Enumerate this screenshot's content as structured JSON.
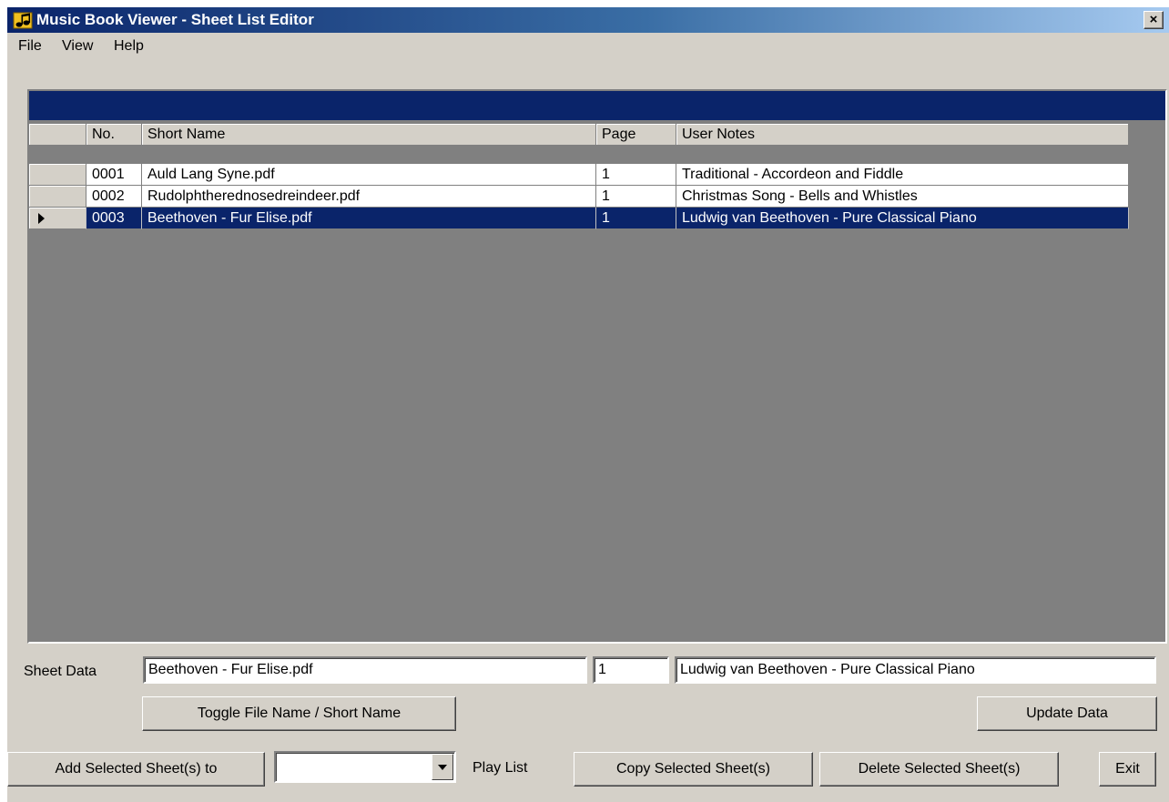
{
  "window": {
    "title": "Music Book Viewer - Sheet List Editor",
    "close_label": "×"
  },
  "menu": {
    "items": [
      "File",
      "View",
      "Help"
    ]
  },
  "grid": {
    "columns": [
      "No.",
      "Short Name",
      "Page",
      "User Notes"
    ],
    "rows": [
      {
        "no": "0001",
        "short_name": "Auld Lang Syne.pdf",
        "page": "1",
        "notes": "Traditional - Accordeon and Fiddle"
      },
      {
        "no": "0002",
        "short_name": "Rudolphtherednosedreindeer.pdf",
        "page": "1",
        "notes": "Christmas Song - Bells and Whistles"
      },
      {
        "no": "0003",
        "short_name": "Beethoven - Fur Elise.pdf",
        "page": "1",
        "notes": "Ludwig van Beethoven - Pure Classical Piano"
      }
    ],
    "selected_row": 2
  },
  "sheet_data": {
    "label": "Sheet Data",
    "name_value": "Beethoven - Fur Elise.pdf",
    "page_value": "1",
    "notes_value": "Ludwig van Beethoven - Pure Classical Piano"
  },
  "buttons": {
    "toggle_name": "Toggle File Name / Short Name",
    "update_data": "Update Data",
    "add_selected": "Add Selected Sheet(s) to",
    "copy_selected": "Copy Selected Sheet(s)",
    "delete_selected": "Delete Selected Sheet(s)",
    "exit": "Exit"
  },
  "playlist": {
    "label": "Play List",
    "selected": ""
  },
  "colors": {
    "titlebar": "#0a246a",
    "selection": "#0a246a",
    "face": "#d4d0c8",
    "grid_background": "#808080"
  }
}
